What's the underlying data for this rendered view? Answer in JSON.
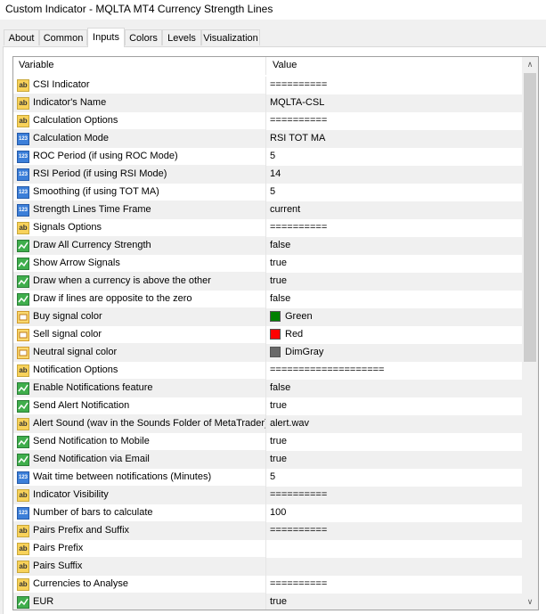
{
  "window": {
    "title": "Custom Indicator - MQLTA MT4 Currency Strength Lines"
  },
  "tabs": [
    {
      "label": "About",
      "active": false
    },
    {
      "label": "Common",
      "active": false
    },
    {
      "label": "Inputs",
      "active": true
    },
    {
      "label": "Colors",
      "active": false
    },
    {
      "label": "Levels",
      "active": false
    },
    {
      "label": "Visualization",
      "active": false
    }
  ],
  "table": {
    "headers": {
      "variable": "Variable",
      "value": "Value"
    },
    "rows": [
      {
        "type": "ab",
        "name": "CSI Indicator",
        "value": "=========="
      },
      {
        "type": "ab",
        "name": "Indicator's Name",
        "value": "MQLTA-CSL"
      },
      {
        "type": "ab",
        "name": "Calculation Options",
        "value": "=========="
      },
      {
        "type": "123",
        "name": "Calculation Mode",
        "value": "RSI TOT MA"
      },
      {
        "type": "123",
        "name": "ROC Period (if using ROC Mode)",
        "value": "5"
      },
      {
        "type": "123",
        "name": "RSI Period (if using RSI Mode)",
        "value": "14"
      },
      {
        "type": "123",
        "name": "Smoothing (if using TOT MA)",
        "value": "5"
      },
      {
        "type": "123",
        "name": "Strength Lines Time Frame",
        "value": "current"
      },
      {
        "type": "ab",
        "name": "Signals Options",
        "value": "=========="
      },
      {
        "type": "bool",
        "name": "Draw All Currency Strength",
        "value": "false"
      },
      {
        "type": "bool",
        "name": "Show Arrow Signals",
        "value": "true"
      },
      {
        "type": "bool",
        "name": "Draw when a currency is above the other",
        "value": "true"
      },
      {
        "type": "bool",
        "name": "Draw if lines are opposite to the zero",
        "value": "false"
      },
      {
        "type": "color",
        "name": "Buy signal color",
        "value": "Green",
        "color": "#008000"
      },
      {
        "type": "color",
        "name": "Sell signal color",
        "value": "Red",
        "color": "#ff0000"
      },
      {
        "type": "color",
        "name": "Neutral signal color",
        "value": "DimGray",
        "color": "#696969"
      },
      {
        "type": "ab",
        "name": "Notification Options",
        "value": "===================="
      },
      {
        "type": "bool",
        "name": "Enable Notifications feature",
        "value": "false"
      },
      {
        "type": "bool",
        "name": "Send Alert Notification",
        "value": "true"
      },
      {
        "type": "ab",
        "name": "Alert Sound (wav in the Sounds Folder of MetaTrader)",
        "value": "alert.wav"
      },
      {
        "type": "bool",
        "name": "Send Notification to Mobile",
        "value": "true"
      },
      {
        "type": "bool",
        "name": "Send Notification via Email",
        "value": "true"
      },
      {
        "type": "123",
        "name": "Wait time between notifications (Minutes)",
        "value": "5"
      },
      {
        "type": "ab",
        "name": "Indicator Visibility",
        "value": "=========="
      },
      {
        "type": "123",
        "name": "Number of bars to calculate",
        "value": "100"
      },
      {
        "type": "ab",
        "name": "Pairs Prefix and Suffix",
        "value": "=========="
      },
      {
        "type": "ab",
        "name": "Pairs Prefix",
        "value": ""
      },
      {
        "type": "ab",
        "name": "Pairs Suffix",
        "value": ""
      },
      {
        "type": "ab",
        "name": "Currencies to Analyse",
        "value": "=========="
      },
      {
        "type": "bool",
        "name": "EUR",
        "value": "true"
      }
    ]
  },
  "icons": {
    "ab": "ab",
    "123": "123"
  },
  "scrollbar": {
    "up_glyph": "∧",
    "down_glyph": "∨",
    "position": 0
  }
}
